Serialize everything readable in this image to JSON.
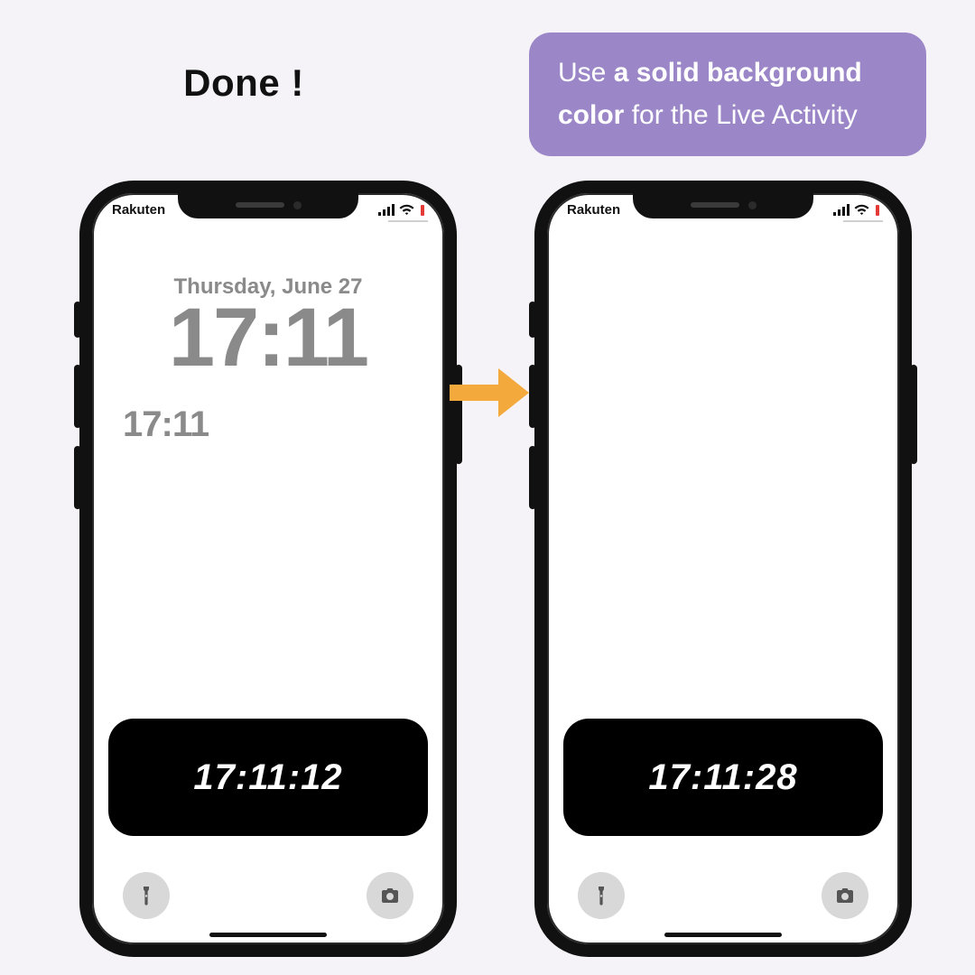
{
  "heading": "Done !",
  "tip": {
    "pre": "Use ",
    "bold": "a solid background color",
    "post": " for the Live Activity"
  },
  "statusbar": {
    "carrier": "Rakuten"
  },
  "colors": {
    "tip_bg": "#9b87c7",
    "arrow": "#f3a93c",
    "battery_low": "#e53935"
  },
  "phone_left": {
    "date": "Thursday, June 27",
    "big_clock": "17:11",
    "small_clock": "17:11",
    "live_activity_time": "17:11:12"
  },
  "phone_right": {
    "live_activity_time": "17:11:28"
  }
}
